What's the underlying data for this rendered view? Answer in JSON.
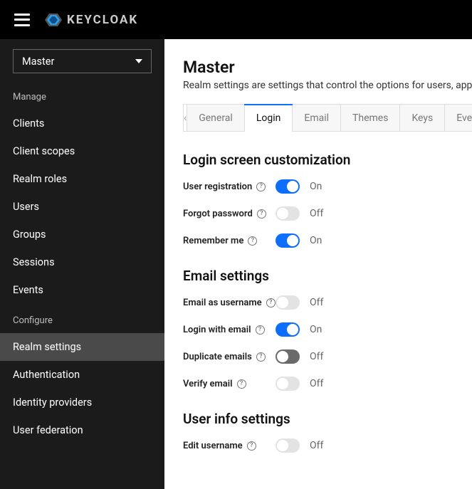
{
  "header": {
    "brand": "KEYCLOAK"
  },
  "sidebar": {
    "realm_selector": {
      "selected": "Master"
    },
    "sections": [
      {
        "label": "Manage",
        "items": [
          "Clients",
          "Client scopes",
          "Realm roles",
          "Users",
          "Groups",
          "Sessions",
          "Events"
        ]
      },
      {
        "label": "Configure",
        "items": [
          "Realm settings",
          "Authentication",
          "Identity providers",
          "User federation"
        ]
      }
    ],
    "active_item": "Realm settings"
  },
  "main": {
    "title": "Master",
    "subtitle": "Realm settings are settings that control the options for users, application",
    "tabs": [
      "General",
      "Login",
      "Email",
      "Themes",
      "Keys",
      "Events"
    ],
    "active_tab": "Login",
    "state_labels": {
      "on": "On",
      "off": "Off"
    },
    "sections": [
      {
        "heading": "Login screen customization",
        "items": [
          {
            "key": "user_registration",
            "label": "User registration",
            "on": true,
            "disabled": false
          },
          {
            "key": "forgot_password",
            "label": "Forgot password",
            "on": false,
            "disabled": false
          },
          {
            "key": "remember_me",
            "label": "Remember me",
            "on": true,
            "disabled": false
          }
        ]
      },
      {
        "heading": "Email settings",
        "items": [
          {
            "key": "email_as_username",
            "label": "Email as username",
            "on": false,
            "disabled": false
          },
          {
            "key": "login_with_email",
            "label": "Login with email",
            "on": true,
            "disabled": false
          },
          {
            "key": "duplicate_emails",
            "label": "Duplicate emails",
            "on": false,
            "disabled": true
          },
          {
            "key": "verify_email",
            "label": "Verify email",
            "on": false,
            "disabled": false
          }
        ]
      },
      {
        "heading": "User info settings",
        "items": [
          {
            "key": "edit_username",
            "label": "Edit username",
            "on": false,
            "disabled": false
          }
        ]
      }
    ]
  }
}
